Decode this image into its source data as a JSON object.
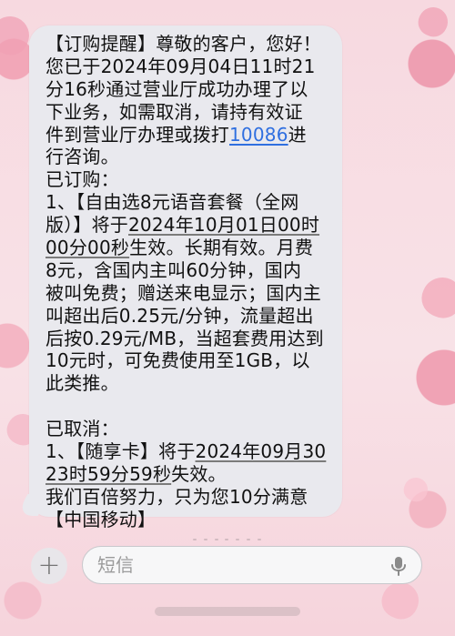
{
  "message": {
    "lines": [
      "【订购提醒】尊敬的客户，您好！",
      "您已于2024年09月04日11时21",
      "分16秒通过营业厅成功办理了以",
      "下业务，如需取消，请持有效证",
      "件到营业厅办理或拨打",
      "10086",
      "进",
      "行咨询。",
      "已订购：",
      "1、【自由选8元语音套餐（全网",
      "版）】将于",
      "2024年10月01日00时",
      "00分00秒",
      "生效。长期有效。月费",
      "8元，含国内主叫60分钟，国内",
      "被叫免费；赠送来电显示；国内主",
      "叫超出后0.25元/分钟，流量超出",
      "后按0.29元/MB，当超套费用达到",
      "10元时，可免费使用至1GB，以",
      "此类推。",
      "已取消：",
      "1、【随享卡】将于",
      "2024年09月30",
      "23时59分59秒",
      "失效。",
      "我们百倍努力，只为您10分满意",
      "【中国移动】"
    ]
  },
  "composer": {
    "placeholder": "短信"
  },
  "colors": {
    "bubble": "#e9e9ee",
    "link": "#2f6fe0",
    "background": "#f6d3dc"
  },
  "icons": {
    "plus": "plus-icon",
    "microphone": "microphone-icon"
  }
}
